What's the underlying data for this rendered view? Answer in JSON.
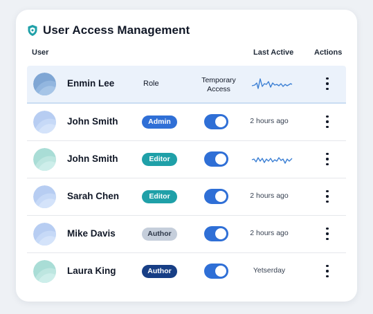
{
  "header": {
    "title": "User Access Management",
    "icon": "shield-icon",
    "accent_color": "#1fa0a8"
  },
  "columns": {
    "user": "User",
    "last_active": "Last Active",
    "actions": "Actions"
  },
  "header_row": {
    "name": "Enmin Lee",
    "role_label": "Role",
    "temp_access_label": "Temporary Access",
    "last_active": "activity-sparkline"
  },
  "users": [
    {
      "name": "John Smith",
      "role": "Admin",
      "temp_access": true,
      "last_active": "2 hours ago"
    },
    {
      "name": "John Smith",
      "role": "Editor",
      "temp_access": true,
      "last_active": "activity-sparkline"
    },
    {
      "name": "Sarah Chen",
      "role": "Editor",
      "temp_access": true,
      "last_active": "2 hours ago"
    },
    {
      "name": "Mike Davis",
      "role": "Author",
      "temp_access": true,
      "last_active": "2 hours ago"
    },
    {
      "name": "Laura King",
      "role": "Author",
      "temp_access": true,
      "last_active": "Yetserday"
    }
  ],
  "colors": {
    "admin": "#2f6fd6",
    "editor": "#1fa0a8",
    "author_light": "#c5cedb",
    "author_dark": "#173e85",
    "toggle_on": "#2f6fd6",
    "sparkline": "#3b7fd4"
  }
}
